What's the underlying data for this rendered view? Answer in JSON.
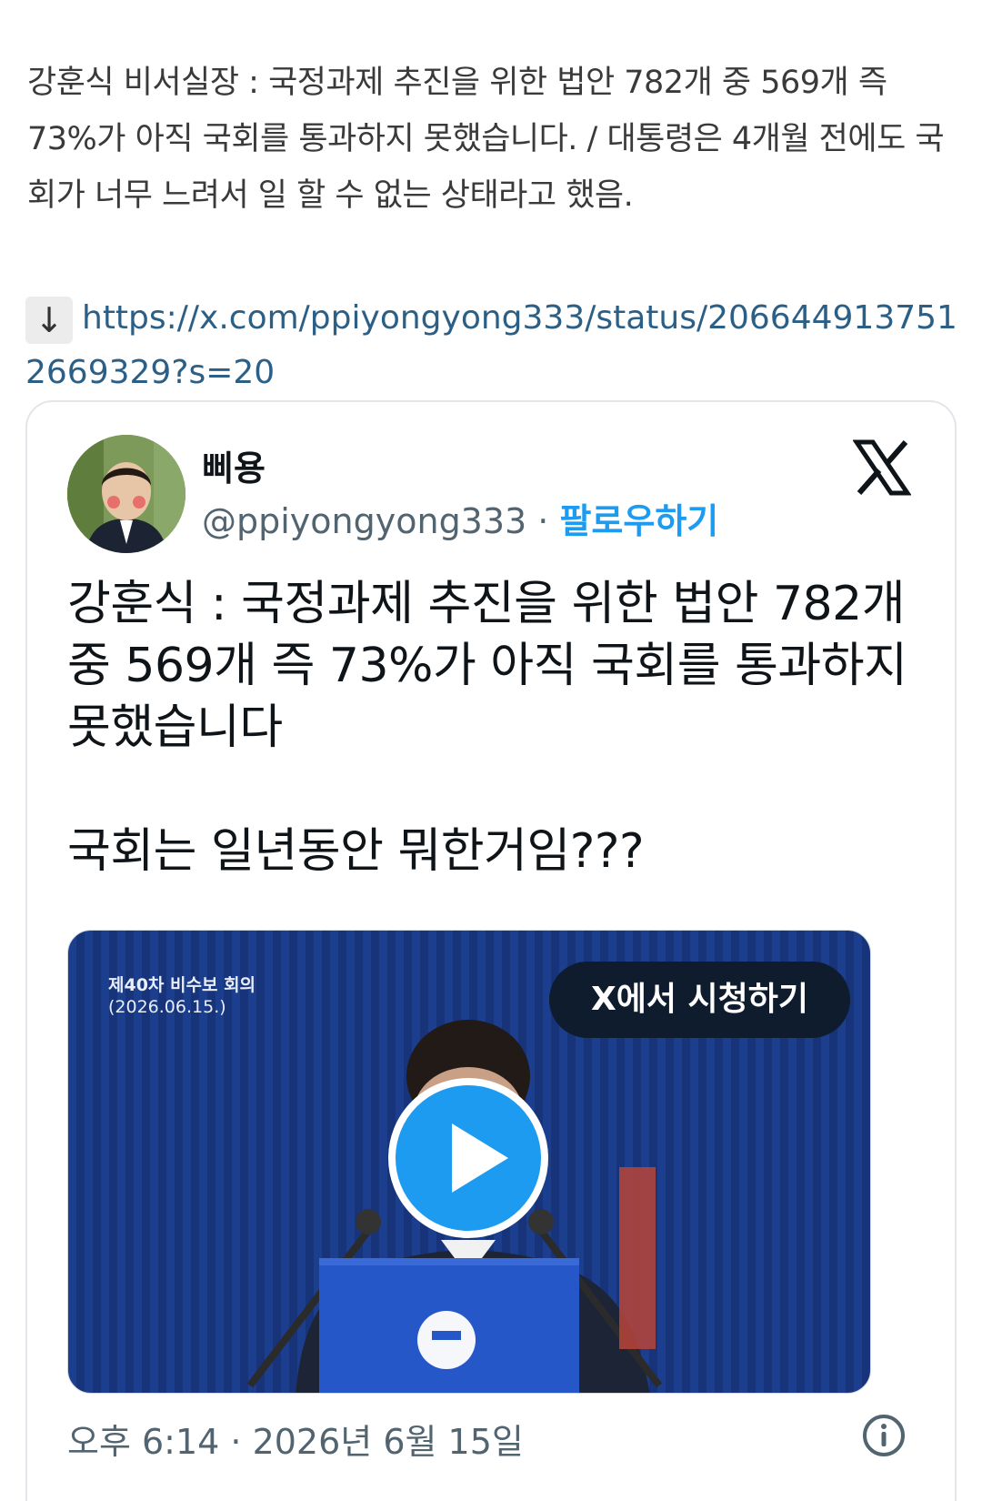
{
  "post": {
    "text": "강훈식 비서실장 : 국정과제 추진을 위한 법안 782개 중 569개 즉 73%가 아직 국회를 통과하지 못했습니다. / 대통령은 4개월 전에도 국회가 너무 느려서 일 할 수 없는 상태라고 했음.",
    "arrow": "↓",
    "link": "https://x.com/ppiyongyong333/status/2066449137512669329?s=20"
  },
  "embed": {
    "author_name": "삐용",
    "author_handle": "@ppiyongyong333",
    "separator": " · ",
    "follow_label": "팔로우하기",
    "logo_icon": "x-logo-icon",
    "tweet_text": "강훈식 : 국정과제 추진을 위한 법안 782개 중 569개 즉 73%가 아직 국회를 통과하지 못했습니다\n\n국회는 일년동안 뭐한거임???",
    "media": {
      "caption_line1": "제40차 비수보 회의",
      "caption_line2": "(2026.06.15.)",
      "watch_label": "X에서 시청하기",
      "play_icon": "play-icon"
    },
    "timestamp": "오후 6:14 · 2026년 6월 15일",
    "info_icon": "info-icon"
  },
  "colors": {
    "link": "#2c5f86",
    "follow": "#1d9bf0",
    "media_bg": "#1b3e8f"
  }
}
